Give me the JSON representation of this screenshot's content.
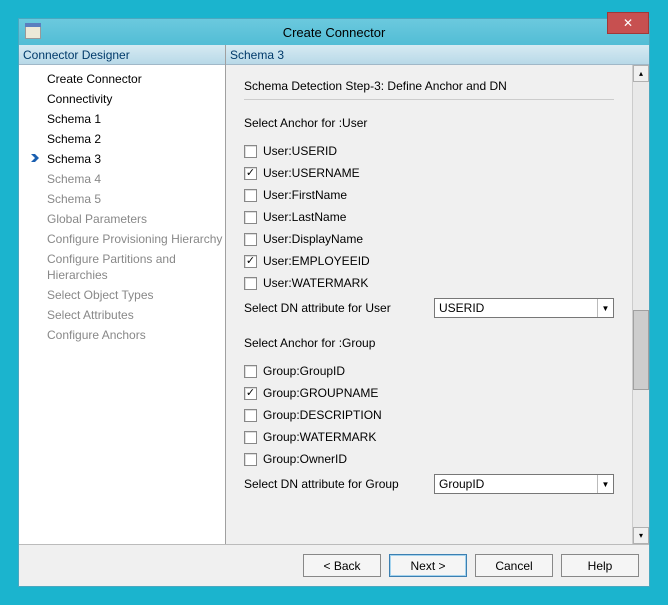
{
  "window": {
    "title": "Create Connector"
  },
  "left": {
    "header": "Connector Designer",
    "items": [
      {
        "label": "Create Connector",
        "state": "done"
      },
      {
        "label": "Connectivity",
        "state": "done"
      },
      {
        "label": "Schema 1",
        "state": "done"
      },
      {
        "label": "Schema 2",
        "state": "done"
      },
      {
        "label": "Schema 3",
        "state": "current"
      },
      {
        "label": "Schema 4",
        "state": "disabled"
      },
      {
        "label": "Schema 5",
        "state": "disabled"
      },
      {
        "label": "Global Parameters",
        "state": "disabled"
      },
      {
        "label": "Configure Provisioning Hierarchy",
        "state": "disabled"
      },
      {
        "label": "Configure Partitions and Hierarchies",
        "state": "disabled"
      },
      {
        "label": "Select Object Types",
        "state": "disabled"
      },
      {
        "label": "Select Attributes",
        "state": "disabled"
      },
      {
        "label": "Configure Anchors",
        "state": "disabled"
      }
    ]
  },
  "right": {
    "header": "Schema 3",
    "step_title": "Schema Detection Step-3: Define Anchor and DN",
    "sections": {
      "user": {
        "label": "Select Anchor for :User",
        "items": [
          {
            "label": "User:USERID",
            "checked": false
          },
          {
            "label": "User:USERNAME",
            "checked": true
          },
          {
            "label": "User:FirstName",
            "checked": false
          },
          {
            "label": "User:LastName",
            "checked": false
          },
          {
            "label": "User:DisplayName",
            "checked": false
          },
          {
            "label": "User:EMPLOYEEID",
            "checked": true
          },
          {
            "label": "User:WATERMARK",
            "checked": false
          }
        ],
        "dn_label": "Select DN attribute for User",
        "dn_value": "USERID"
      },
      "group": {
        "label": "Select Anchor for :Group",
        "items": [
          {
            "label": "Group:GroupID",
            "checked": false
          },
          {
            "label": "Group:GROUPNAME",
            "checked": true
          },
          {
            "label": "Group:DESCRIPTION",
            "checked": false
          },
          {
            "label": "Group:WATERMARK",
            "checked": false
          },
          {
            "label": "Group:OwnerID",
            "checked": false
          }
        ],
        "dn_label": "Select DN attribute for Group",
        "dn_value": "GroupID"
      }
    }
  },
  "buttons": {
    "back": "<  Back",
    "next": "Next  >",
    "cancel": "Cancel",
    "help": "Help"
  }
}
